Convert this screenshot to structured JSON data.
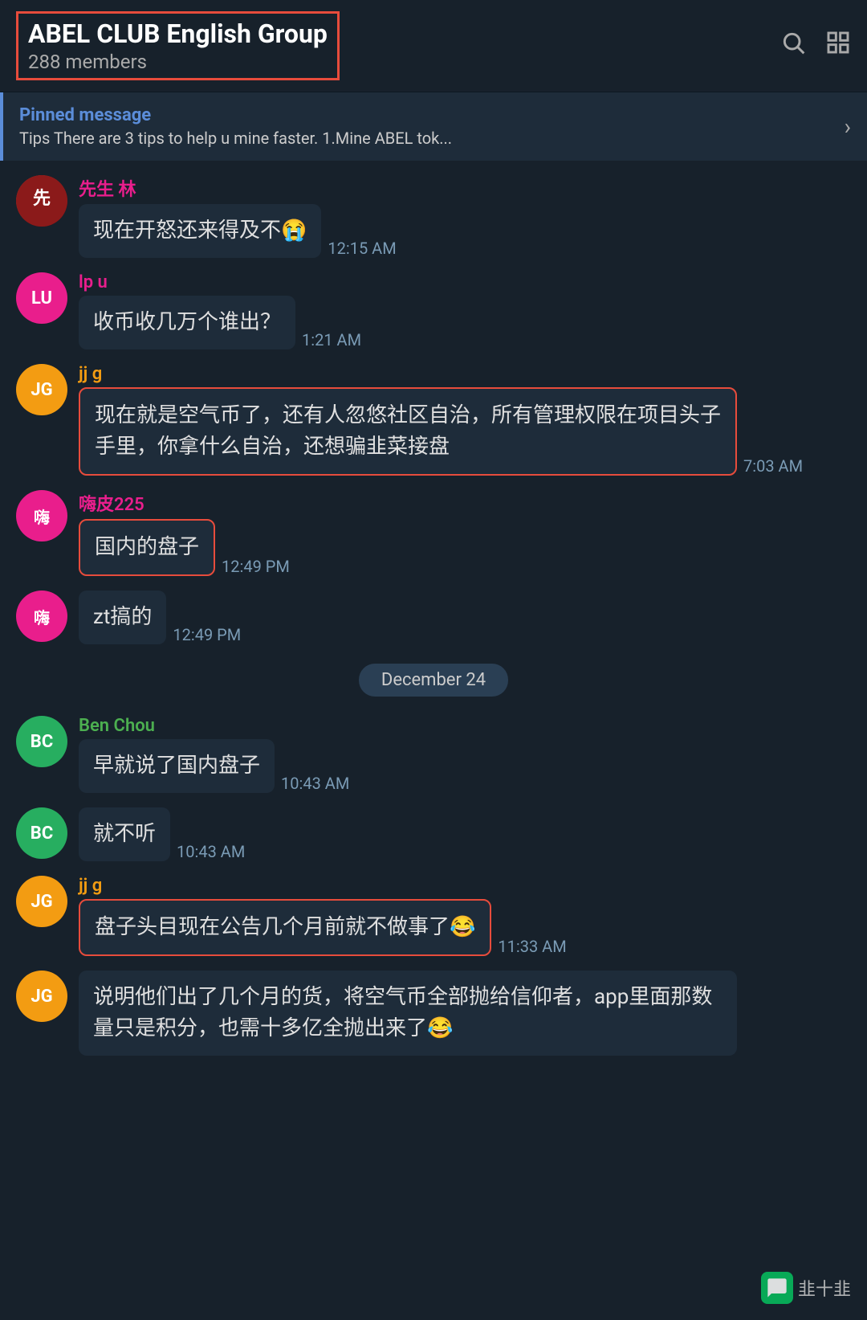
{
  "header": {
    "title": "ABEL CLUB English Group",
    "members": "288 members",
    "search_label": "search",
    "layout_label": "layout"
  },
  "pinned": {
    "label": "Pinned message",
    "text": "Tips   There are 3 tips to help u mine faster. 1.Mine ABEL tok..."
  },
  "messages": [
    {
      "id": "msg-xiansheng",
      "sender": "先生 林",
      "sender_color": "pink",
      "avatar_label": "先",
      "avatar_type": "image",
      "text": "现在开怒还来得及不😭",
      "time": "12:15 AM",
      "highlighted": false
    },
    {
      "id": "msg-lpu",
      "sender": "lp u",
      "sender_color": "pink",
      "avatar_label": "LU",
      "avatar_type": "lu",
      "text": "收币收几万个谁出？",
      "time": "1:21 AM",
      "highlighted": false
    },
    {
      "id": "msg-jg1",
      "sender": "jj g",
      "sender_color": "orange",
      "avatar_label": "JG",
      "avatar_type": "jg",
      "text": "现在就是空气币了，还有人忽悠社区自治，所有管理权限在项目头子手里，你拿什么自治，还想骗韭菜接盘",
      "time": "7:03 AM",
      "highlighted": true
    },
    {
      "id": "msg-noise1",
      "sender": "嗨皮225",
      "sender_color": "pink",
      "avatar_label": "嗨",
      "avatar_type": "noise",
      "text": "国内的盘子",
      "time": "12:49 PM",
      "highlighted": true
    },
    {
      "id": "msg-noise2",
      "sender": "",
      "sender_color": "",
      "avatar_label": "嗨",
      "avatar_type": "noise",
      "text": "zt搞的",
      "time": "12:49 PM",
      "highlighted": false
    },
    {
      "id": "date-sep",
      "type": "separator",
      "date": "December 24"
    },
    {
      "id": "msg-bc1",
      "sender": "Ben Chou",
      "sender_color": "green",
      "avatar_label": "BC",
      "avatar_type": "bc",
      "text": "早就说了国内盘子",
      "time": "10:43 AM",
      "highlighted": false
    },
    {
      "id": "msg-bc2",
      "sender": "",
      "sender_color": "",
      "avatar_label": "BC",
      "avatar_type": "bc",
      "text": "就不听",
      "time": "10:43 AM",
      "highlighted": false
    },
    {
      "id": "msg-jg2",
      "sender": "jj g",
      "sender_color": "orange",
      "avatar_label": "JG",
      "avatar_type": "jg",
      "text": "盘子头目现在公告几个月前就不做事了😂",
      "time": "11:33 AM",
      "highlighted": true
    },
    {
      "id": "msg-jg3",
      "sender": "",
      "sender_color": "",
      "avatar_label": "JG",
      "avatar_type": "jg",
      "text": "说明他们出了几个月的货，将空气币全部抛给信仰者，app里面那数量只是积分，也需十多亿全抛出来了😂",
      "time": "",
      "highlighted": false
    }
  ],
  "watermark": {
    "icon": "💬",
    "text": "韭十韭"
  }
}
